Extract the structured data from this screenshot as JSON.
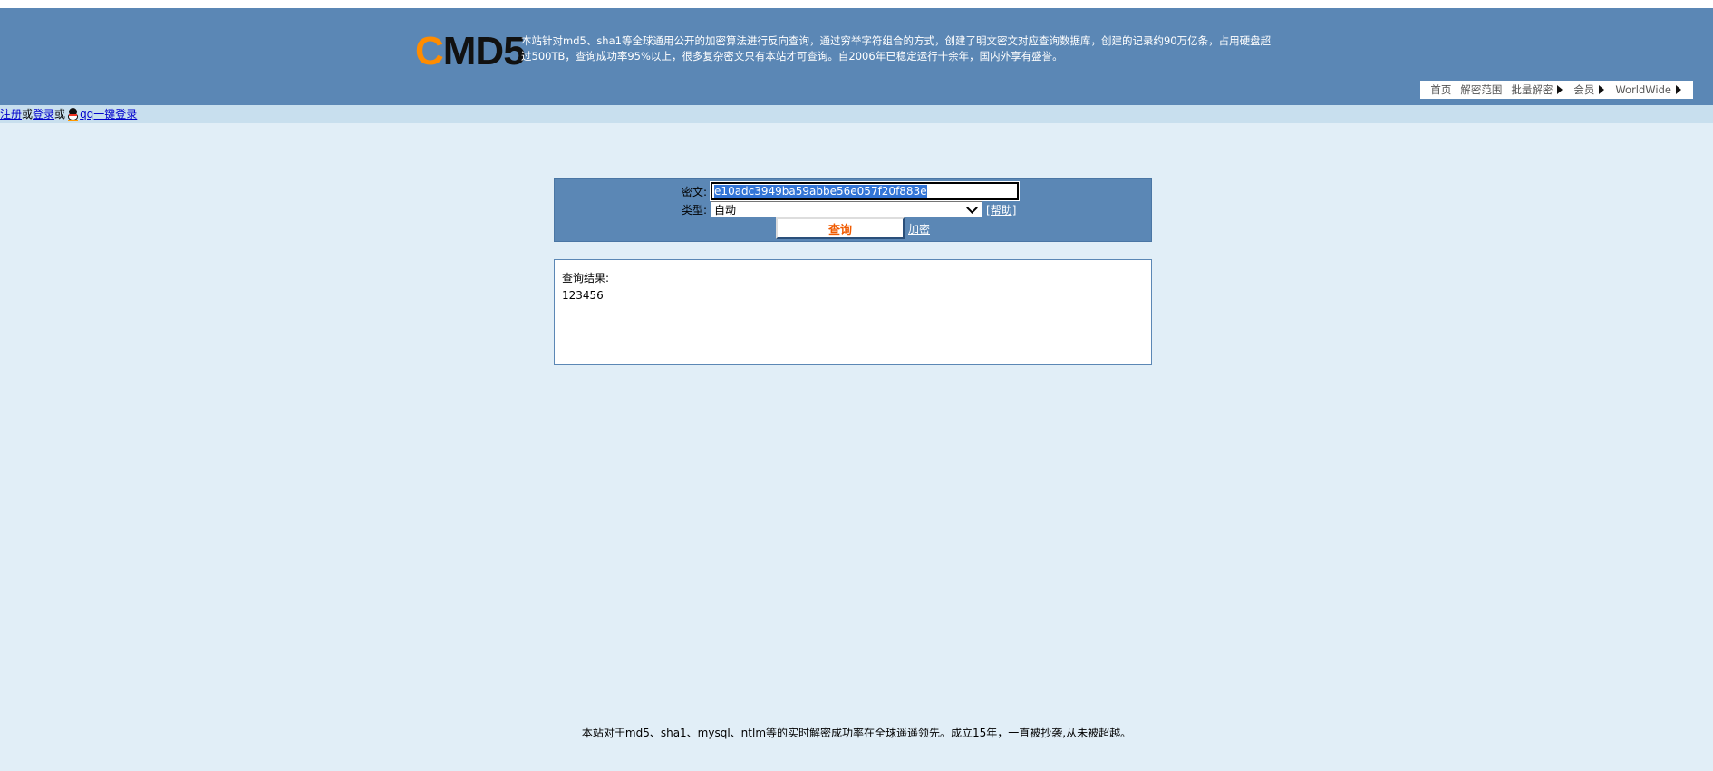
{
  "header": {
    "logo_first": "C",
    "logo_rest": "MD5",
    "description_line1": "本站针对md5、sha1等全球通用公开的加密算法进行反向查询，通过穷举字符组合的方式，创建了明文密文对应查询数据库，创建的记录约90万亿条，占用硬盘超",
    "description_line2": "过500TB，查询成功率95%以上，很多复杂密文只有本站才可查询。自2006年已稳定运行十余年，国内外享有盛誉。",
    "nav": [
      {
        "label": "首页",
        "arrow": false
      },
      {
        "label": "解密范围",
        "arrow": false
      },
      {
        "label": "批量解密",
        "arrow": true
      },
      {
        "label": "会员",
        "arrow": true
      },
      {
        "label": "WorldWide",
        "arrow": true
      }
    ]
  },
  "login": {
    "register": "注册",
    "or1": "或",
    "login": "登录",
    "or2": "或",
    "qq_login": "qq一键登录"
  },
  "form": {
    "cipher_label": "密文:",
    "cipher_value": "e10adc3949ba59abbe56e057f20f883e",
    "type_label": "类型:",
    "type_value": "自动",
    "help_link": "[帮助]",
    "query_button": "查询",
    "encrypt_link": "加密"
  },
  "result": {
    "title": "查询结果:",
    "value": "123456"
  },
  "footer": {
    "text": "本站对于md5、sha1、mysql、ntlm等的实时解密成功率在全球遥遥领先。成立15年，一直被抄袭,从未被超越。"
  },
  "colors": {
    "header_bg": "#5b87b5",
    "page_bg": "#e1eef7",
    "logo_accent": "#ff8c00",
    "query_text": "#f05a00"
  }
}
